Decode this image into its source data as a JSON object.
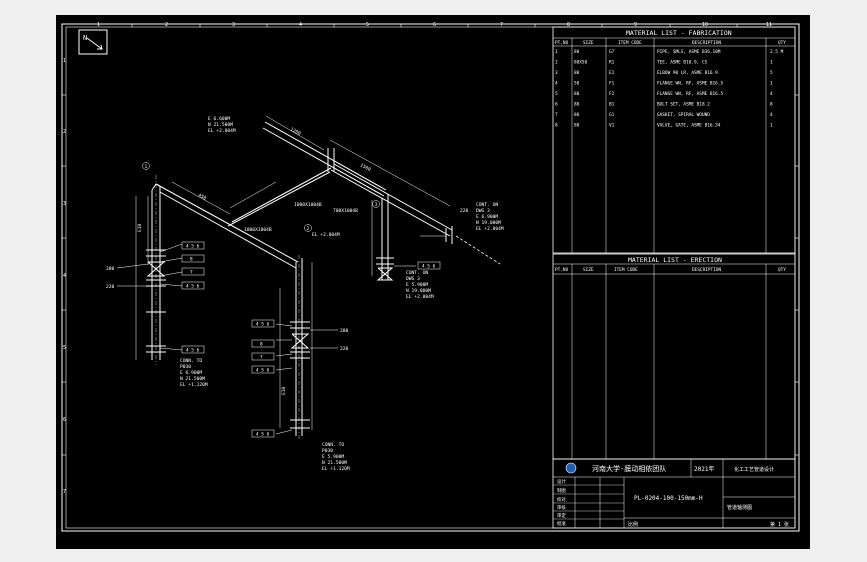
{
  "colors": {
    "background": "#000000",
    "outer": "#f0f0f0",
    "lines": "#ffffff",
    "logo": "#1f5fb8"
  },
  "border": {
    "cols": [
      "1",
      "2",
      "3",
      "4",
      "5",
      "6",
      "7",
      "8",
      "9",
      "10",
      "11"
    ],
    "rows": [
      "1",
      "2",
      "3",
      "4",
      "5",
      "6",
      "7"
    ]
  },
  "north_label": "N",
  "fabrication": {
    "title": "MATERIAL LIST - FABRICATION",
    "headers": [
      "PT.NO",
      "SIZE",
      "ITEM CODE",
      "DESCRIPTION",
      "QTY"
    ],
    "rows": [
      [
        "1",
        "80",
        "G7",
        "PIPE, SMLS, ASME B36.10M",
        "2.5 M"
      ],
      [
        "2",
        "80X50",
        "R1",
        "TEE, ASME B16.9, CS",
        "1"
      ],
      [
        "3",
        "80",
        "E1",
        "ELBOW 90 LR, ASME B16.9",
        "5"
      ],
      [
        "4",
        "50",
        "F1",
        "FLANGE WN, RF, ASME B16.5",
        "1"
      ],
      [
        "5",
        "80",
        "F2",
        "FLANGE WN, RF, ASME B16.5",
        "4"
      ],
      [
        "6",
        "80",
        "B1",
        "BOLT SET, ASME B18.2",
        "8"
      ],
      [
        "7",
        "80",
        "G1",
        "GASKET, SPIRAL WOUND",
        "4"
      ],
      [
        "8",
        "80",
        "V1",
        "VALVE, GATE, ASME B16.34",
        "1"
      ]
    ]
  },
  "erection": {
    "title": "MATERIAL LIST - ERECTION",
    "headers": [
      "PT.NO",
      "SIZE",
      "ITEM CODE",
      "DESCRIPTION",
      "QTY"
    ]
  },
  "title_block": {
    "org": "河南大学-膜动相依团队",
    "year": "2021年",
    "project": "化工工艺管道设计",
    "drawing_no": "PL-0204-100-150mm-H",
    "drawing_name": "管道轴测图",
    "sheet": "第 1 张",
    "scale": "比例",
    "roles": [
      "设计",
      "制图",
      "校对",
      "审核",
      "审定",
      "批准"
    ]
  },
  "annotations": [
    "E 6.600M",
    "N 21.500M",
    "EL +2.804M",
    "1000X1004B",
    "700X1004B",
    "1000X1004B",
    "EL +2.804M",
    "CONN. TO",
    "P030",
    "E 6.900M",
    "N 21.500M",
    "EL +1.120M",
    "E 5.900M",
    "N 21.500M",
    "EL +1.120M",
    "CONT. ON",
    "DWG 3",
    "E 6.900M",
    "N 19.000M",
    "EL +2.804M",
    "4 5 6",
    "8",
    "7",
    "4 5 6",
    "4 5 6",
    "4 5 6",
    "8",
    "7",
    "4 5 6",
    "4 5 6",
    "4 5 6",
    "1280",
    "1500",
    "450",
    "E10",
    "E10",
    "280",
    "220",
    "280",
    "220",
    "220",
    "1",
    "2",
    "3"
  ]
}
